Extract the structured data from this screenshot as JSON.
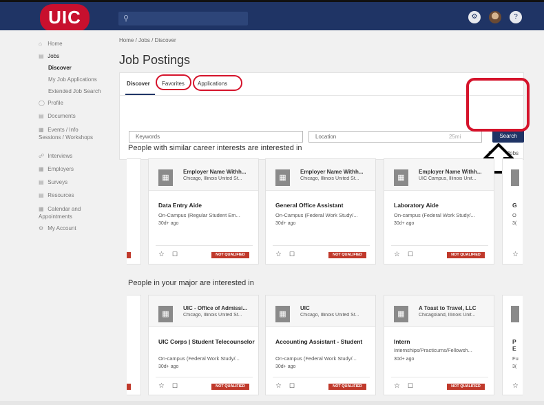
{
  "header": {
    "logo": "UIC",
    "search_icon": "search-icon",
    "icons": [
      "bell-icon",
      "user-avatar",
      "help-icon"
    ]
  },
  "sidebar": {
    "items": [
      {
        "icon": "home-icon",
        "label": "Home"
      },
      {
        "icon": "briefcase-icon",
        "label": "Jobs"
      },
      {
        "label": "Discover",
        "sub": true,
        "active": true
      },
      {
        "label": "My Job Applications",
        "sub": true
      },
      {
        "label": "Extended Job Search",
        "sub": true
      },
      {
        "icon": "profile-icon",
        "label": "Profile"
      },
      {
        "icon": "documents-icon",
        "label": "Documents"
      },
      {
        "icon": "calendar-icon",
        "label": "Events / Info Sessions / Workshops"
      },
      {
        "icon": "interviews-icon",
        "label": "Interviews"
      },
      {
        "icon": "employers-icon",
        "label": "Employers"
      },
      {
        "icon": "surveys-icon",
        "label": "Surveys"
      },
      {
        "icon": "resources-icon",
        "label": "Resources"
      },
      {
        "icon": "calendar-icon",
        "label": "Calendar and Appointments"
      },
      {
        "icon": "gear-icon",
        "label": "My Account"
      }
    ]
  },
  "main": {
    "breadcrumb": "Home / Jobs / Discover",
    "title": "Job Postings",
    "tabs": [
      "Discover",
      "Favorites",
      "Applications"
    ],
    "keywords_placeholder": "Keywords",
    "location_placeholder": "Location",
    "radius": "25mi",
    "search_button": "Search",
    "see_all": "See All Jobs",
    "section1_title": "People with similar career interests are interested in",
    "section2_title": "People in your major are interested in",
    "badge_text": "NOT QUALIFIED",
    "section1_cards": [
      {
        "employer": "Employer Name Withh...",
        "location": "Chicago, Illinois United St...",
        "title": "Data Entry Aide",
        "type": "On-Campus (Regular Student Em...",
        "posted": "30d+ ago"
      },
      {
        "employer": "Employer Name Withh...",
        "location": "Chicago, Illinois United St...",
        "title": "General Office Assistant",
        "type": "On-Campus (Federal Work Study/...",
        "posted": "30d+ ago"
      },
      {
        "employer": "Employer Name Withh...",
        "location": "UIC Campus, Illinois Unit...",
        "title": "Laboratory Aide",
        "type": "On-campus (Federal Work Study/...",
        "posted": "30d+ ago"
      }
    ],
    "section2_cards": [
      {
        "employer": "UIC - Office of Admissi...",
        "location": "Chicago, Illinois United St...",
        "title": "UIC Corps | Student Telecounselor",
        "type": "On-campus (Federal Work Study/...",
        "posted": "30d+ ago"
      },
      {
        "employer": "UIC",
        "location": "Chicago, Illinois United St...",
        "title": "Accounting Assistant - Student",
        "type": "On-campus (Federal Work Study/...",
        "posted": "30d+ ago"
      },
      {
        "employer": "A Toast to Travel, LLC",
        "location": "Chicagoland, Illinois Unit...",
        "title": "Intern",
        "type": "Internships/Practicums/Fellowsh...",
        "posted": "30d+ ago"
      }
    ],
    "partial_right": {
      "s1_title": "G",
      "s1_type": "O",
      "s1_posted": "3(",
      "s2_title": "P",
      "s2_title2": "E",
      "s2_type": "Fu",
      "s2_posted": "3("
    }
  },
  "colors": {
    "header": "#1f3465",
    "brand_red": "#c8102e",
    "badge": "#c0392b",
    "annotation": "#d5132b"
  }
}
